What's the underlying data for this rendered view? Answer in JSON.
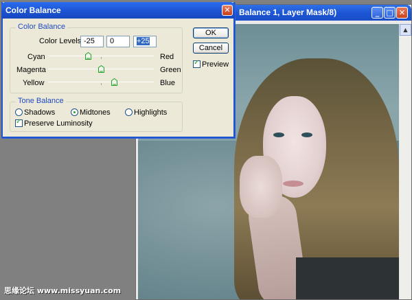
{
  "document": {
    "title": "Balance 1, Layer Mask/8)",
    "controls": {
      "minimize": "_",
      "maximize": "□",
      "close": "✕"
    },
    "scroll_up": "▲"
  },
  "dialog": {
    "title": "Color Balance",
    "close": "✕",
    "color_balance_group": "Color Balance",
    "color_levels_label": "Color Levels:",
    "levels": [
      "-25",
      "0",
      "+25"
    ],
    "sliders": [
      {
        "left": "Cyan",
        "right": "Red",
        "value": -25
      },
      {
        "left": "Magenta",
        "right": "Green",
        "value": 0
      },
      {
        "left": "Yellow",
        "right": "Blue",
        "value": 25
      }
    ],
    "tone_group": "Tone Balance",
    "tones": [
      {
        "label": "Shadows",
        "selected": false
      },
      {
        "label": "Midtones",
        "selected": true
      },
      {
        "label": "Highlights",
        "selected": false
      }
    ],
    "preserve_luminosity": {
      "label": "Preserve Luminosity",
      "checked": true
    },
    "ok": "OK",
    "cancel": "Cancel",
    "preview": {
      "label": "Preview",
      "checked": true
    }
  },
  "watermark": "思缘论坛 www.missyuan.com",
  "colors": {
    "accent": "#1f48c2",
    "titlebar": "#1b51d0",
    "check": "#21a121"
  }
}
